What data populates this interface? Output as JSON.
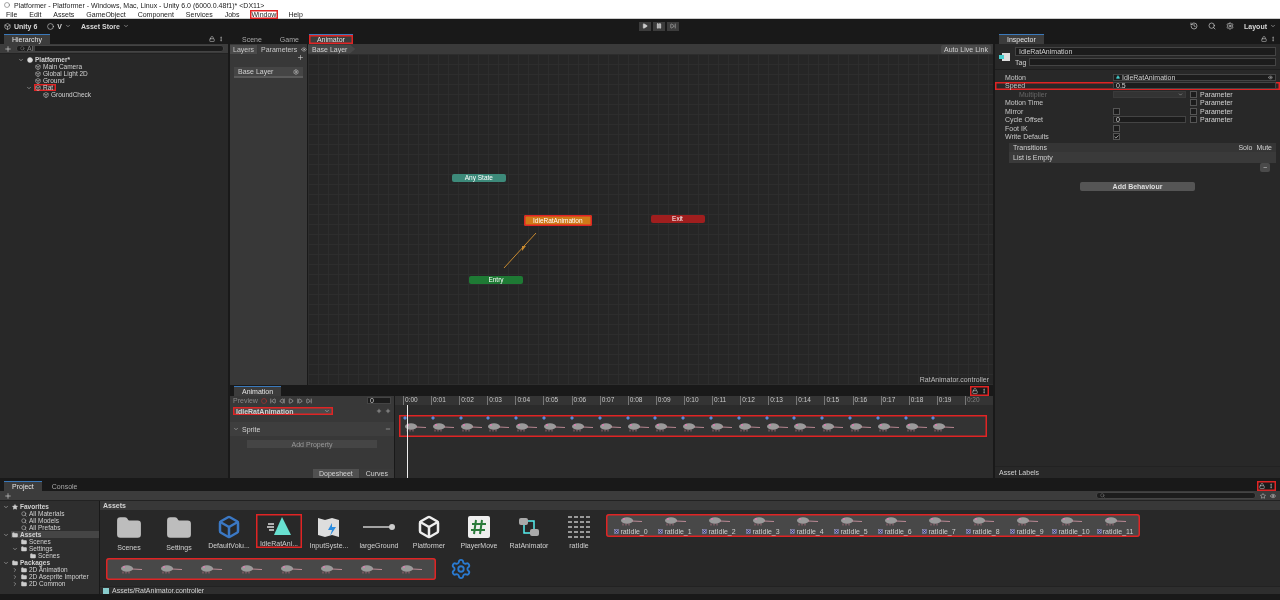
{
  "window": {
    "title": "Platformer - Platformer - Windows, Mac, Linux - Unity 6.0 (6000.0.48f1)* <DX11>"
  },
  "menu": [
    {
      "label": "File",
      "highlighted": false
    },
    {
      "label": "Edit",
      "highlighted": false
    },
    {
      "label": "Assets",
      "highlighted": false
    },
    {
      "label": "GameObject",
      "highlighted": false
    },
    {
      "label": "Component",
      "highlighted": false
    },
    {
      "label": "Services",
      "highlighted": false
    },
    {
      "label": "Jobs",
      "highlighted": false
    },
    {
      "label": "Window",
      "highlighted": true
    },
    {
      "label": "Help",
      "highlighted": false
    }
  ],
  "toolbar": {
    "account": "Unity 6",
    "user": "V",
    "store": "Asset Store",
    "layout": "Layout"
  },
  "hierarchy": {
    "title": "Hierarchy",
    "search": "All",
    "tree": [
      {
        "label": "Platformer*",
        "kind": "scene",
        "expanded": true,
        "highlighted": false,
        "children": [
          {
            "label": "Main Camera",
            "kind": "object",
            "highlighted": false
          },
          {
            "label": "Global Light 2D",
            "kind": "object",
            "highlighted": false
          },
          {
            "label": "Ground",
            "kind": "object",
            "highlighted": false
          },
          {
            "label": "Rat",
            "kind": "object",
            "expanded": true,
            "highlighted": true,
            "children": [
              {
                "label": "GroundCheck",
                "kind": "object",
                "highlighted": false
              }
            ]
          }
        ]
      }
    ]
  },
  "center_tabs": [
    {
      "label": "Scene",
      "selected": false,
      "highlighted": false
    },
    {
      "label": "Game",
      "selected": false,
      "highlighted": false
    },
    {
      "label": "Animator",
      "selected": true,
      "highlighted": true
    }
  ],
  "animator": {
    "subtabs": [
      {
        "label": "Layers",
        "selected": true
      },
      {
        "label": "Parameters",
        "selected": false
      }
    ],
    "breadcrumb": "Base Layer",
    "layers": [
      "Base Layer"
    ],
    "live_link": "Auto Live Link",
    "nodes": [
      {
        "label": "Any State",
        "kind": "any",
        "highlighted": false
      },
      {
        "label": "IdleRatAnimation",
        "kind": "default",
        "highlighted": true
      },
      {
        "label": "Exit",
        "kind": "exit",
        "highlighted": false
      },
      {
        "label": "Entry",
        "kind": "entry",
        "highlighted": false
      }
    ],
    "footer": "RatAnimator.controller"
  },
  "animation": {
    "title": "Animation",
    "preview": "Preview",
    "frame": "0",
    "clip": "IdleRatAnimation",
    "clip_highlighted": true,
    "property": "Sprite",
    "add_property": "Add Property",
    "keys_highlighted": true,
    "lock_highlighted": true,
    "ticks": [
      "0:00",
      "0:01",
      "0:02",
      "0:03",
      "0:04",
      "0:05",
      "0:06",
      "0:07",
      "0:08",
      "0:09",
      "0:10",
      "0:11",
      "0:12",
      "0:13",
      "0:14",
      "0:15",
      "0:16",
      "0:17",
      "0:18",
      "0:19",
      "0:20"
    ],
    "modes": [
      {
        "label": "Dopesheet",
        "selected": true
      },
      {
        "label": "Curves",
        "selected": false
      }
    ]
  },
  "inspector": {
    "title": "Inspector",
    "name": "IdleRatAnimation",
    "tag": "Tag",
    "fields": [
      {
        "kind": "object",
        "label": "Motion",
        "value": "IdleRatAnimation",
        "highlighted": false
      },
      {
        "kind": "text",
        "label": "Speed",
        "value": "0.5",
        "highlighted": true
      },
      {
        "kind": "dropdown",
        "label": "Multiplier",
        "param": "Parameter",
        "disabled": true,
        "highlighted": false
      },
      {
        "kind": "param",
        "label": "Motion Time",
        "param": "Parameter",
        "highlighted": false
      },
      {
        "kind": "check",
        "label": "Mirror",
        "checked": false,
        "param": "Parameter",
        "highlighted": false
      },
      {
        "kind": "text",
        "label": "Cycle Offset",
        "value": "0",
        "param": "Parameter",
        "highlighted": false
      },
      {
        "kind": "check",
        "label": "Foot IK",
        "checked": false,
        "highlighted": false
      },
      {
        "kind": "check",
        "label": "Write Defaults",
        "checked": true,
        "highlighted": false
      }
    ],
    "transitions": {
      "title": "Transitions",
      "solo": "Solo",
      "mute": "Mute",
      "empty": "List is Empty",
      "remove": "−"
    },
    "add_behaviour": "Add Behaviour",
    "asset_labels": "Asset Labels"
  },
  "project": {
    "tabs": [
      {
        "label": "Project",
        "selected": true
      },
      {
        "label": "Console",
        "selected": false
      }
    ],
    "tree": [
      {
        "label": "Favorites",
        "kind": "favorites",
        "expanded": true,
        "selected": false,
        "children": [
          {
            "label": "All Materials",
            "kind": "search",
            "selected": false
          },
          {
            "label": "All Models",
            "kind": "search",
            "selected": false
          },
          {
            "label": "All Prefabs",
            "kind": "search",
            "selected": false
          }
        ]
      },
      {
        "label": "Assets",
        "kind": "folder",
        "expanded": true,
        "selected": true,
        "children": [
          {
            "label": "Scenes",
            "kind": "folder",
            "selected": false
          },
          {
            "label": "Settings",
            "kind": "folder",
            "expanded": true,
            "selected": false,
            "children": [
              {
                "label": "Scenes",
                "kind": "folder",
                "selected": false
              }
            ]
          }
        ]
      },
      {
        "label": "Packages",
        "kind": "folder",
        "expanded": true,
        "selected": false,
        "children": [
          {
            "label": "2D Animation",
            "kind": "folder",
            "expanded": false,
            "selected": false
          },
          {
            "label": "2D Aseprite Importer",
            "kind": "folder",
            "expanded": false,
            "selected": false
          },
          {
            "label": "2D Common",
            "kind": "folder",
            "expanded": false,
            "selected": false
          }
        ]
      }
    ],
    "breadcrumb": "Assets",
    "assets": [
      {
        "label": "Scenes",
        "kind": "folder",
        "highlighted": false
      },
      {
        "label": "Settings",
        "kind": "folder",
        "highlighted": false
      },
      {
        "label": "DefaultVolu...",
        "kind": "volume",
        "highlighted": false
      },
      {
        "label": "IdleRatAni...",
        "kind": "anim",
        "highlighted": true
      },
      {
        "label": "InputSyste...",
        "kind": "input",
        "highlighted": false
      },
      {
        "label": "largeGround",
        "kind": "sprite",
        "highlighted": false
      },
      {
        "label": "Platformer",
        "kind": "unity",
        "highlighted": false
      },
      {
        "label": "PlayerMove",
        "kind": "script",
        "highlighted": false
      },
      {
        "label": "RatAnimator",
        "kind": "controller",
        "highlighted": false
      },
      {
        "label": "ratIdle",
        "kind": "sheet",
        "highlighted": false
      }
    ],
    "sprites": [
      "ratIdle_0",
      "ratIdle_1",
      "ratIdle_2",
      "ratIdle_3",
      "ratIdle_4",
      "ratIdle_5",
      "ratIdle_6",
      "ratIdle_7",
      "ratIdle_8",
      "ratIdle_9",
      "ratIdle_10",
      "ratIdle_11"
    ],
    "sprites_highlighted": true,
    "lock_highlighted": true,
    "more_sprites_highlighted": true,
    "path": "Assets/RatAnimator.controller"
  }
}
